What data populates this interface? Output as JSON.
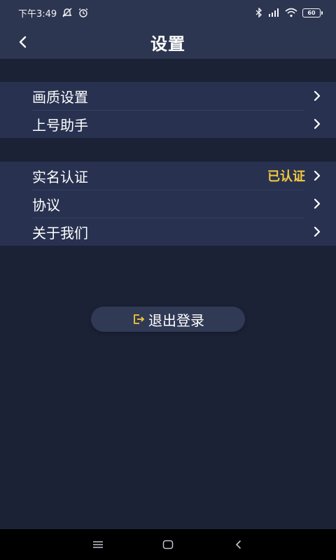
{
  "status_bar": {
    "time": "下午3:49",
    "battery": "60"
  },
  "header": {
    "title": "设置"
  },
  "groups": [
    {
      "items": [
        {
          "label": "画质设置"
        },
        {
          "label": "上号助手"
        }
      ]
    },
    {
      "items": [
        {
          "label": "实名认证",
          "value": "已认证"
        },
        {
          "label": "协议"
        },
        {
          "label": "关于我们"
        }
      ]
    }
  ],
  "logout": {
    "label": "退出登录"
  },
  "colors": {
    "background": "#1b2236",
    "bar": "#2d3650",
    "card": "#283250",
    "accent": "#f5c93d"
  },
  "icons": [
    "back-arrow",
    "chevron-right",
    "logout-icon",
    "menu",
    "home",
    "back"
  ]
}
